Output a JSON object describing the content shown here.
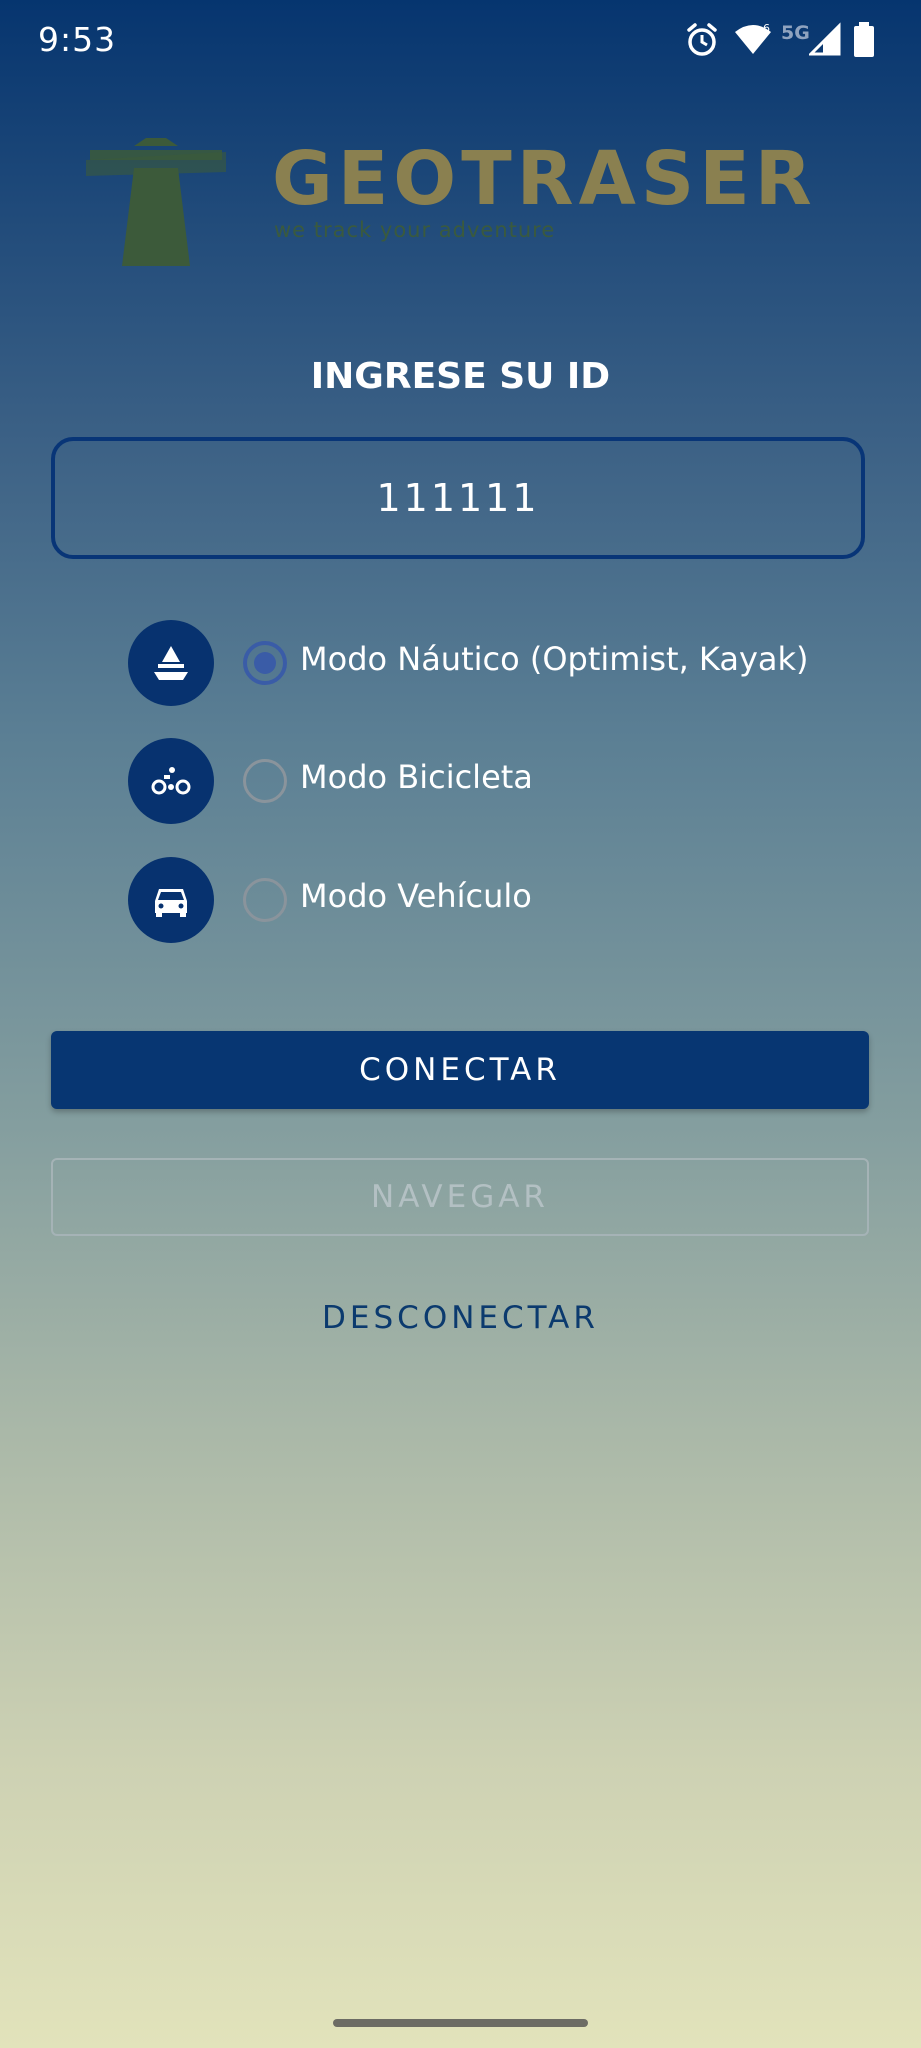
{
  "status_bar": {
    "time": "9:53",
    "network_label": "5G",
    "icons": [
      "alarm-icon",
      "wifi-icon",
      "signal-icon",
      "battery-icon"
    ]
  },
  "logo": {
    "brand": "GEOTRASER",
    "tagline": "we track your adventure"
  },
  "form": {
    "title": "INGRESE SU ID",
    "id_value": "111111"
  },
  "modes": [
    {
      "label": "Modo Náutico (Optimist, Kayak)",
      "icon": "boat-icon",
      "selected": true
    },
    {
      "label": "Modo Bicicleta",
      "icon": "bicycle-icon",
      "selected": false
    },
    {
      "label": "Modo Vehículo",
      "icon": "car-icon",
      "selected": false
    }
  ],
  "buttons": {
    "connect": "CONECTAR",
    "navigate": "NAVEGAR",
    "disconnect": "DESCONECTAR"
  },
  "colors": {
    "primary": "#073672",
    "radio_selected": "#3a5ca7",
    "logo_gold": "#8a8050",
    "logo_green": "#3a5a3e"
  }
}
